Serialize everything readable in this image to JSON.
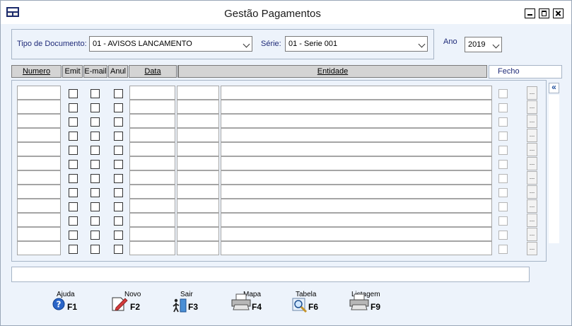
{
  "window": {
    "title": "Gestão Pagamentos"
  },
  "filters": {
    "tipo_label": "Tipo de Documento:",
    "tipo_value": "01 - AVISOS LANCAMENTO",
    "serie_label": "Série:",
    "serie_value": "01 - Serie 001",
    "ano_label": "Ano",
    "ano_value": "2019"
  },
  "table": {
    "columns": [
      "Numero",
      "Emit",
      "E-mail",
      "Anul",
      "Data",
      "",
      "Entidade"
    ],
    "fecho_label": "Fecho",
    "row_count": 12,
    "more_label": "..."
  },
  "sidebar": {
    "collapse_label": "«"
  },
  "toolbar": [
    {
      "label": "Ajuda",
      "key": "F1",
      "icon": "help-icon"
    },
    {
      "label": "Novo",
      "key": "F2",
      "icon": "new-document-icon"
    },
    {
      "label": "Sair",
      "key": "F3",
      "icon": "exit-door-icon"
    },
    {
      "label": "Mapa",
      "key": "F4",
      "icon": "printer-icon"
    },
    {
      "label": "Tabela",
      "key": "F6",
      "icon": "magnifier-icon"
    },
    {
      "label": "Listagem",
      "key": "F9",
      "icon": "printer-icon"
    }
  ]
}
